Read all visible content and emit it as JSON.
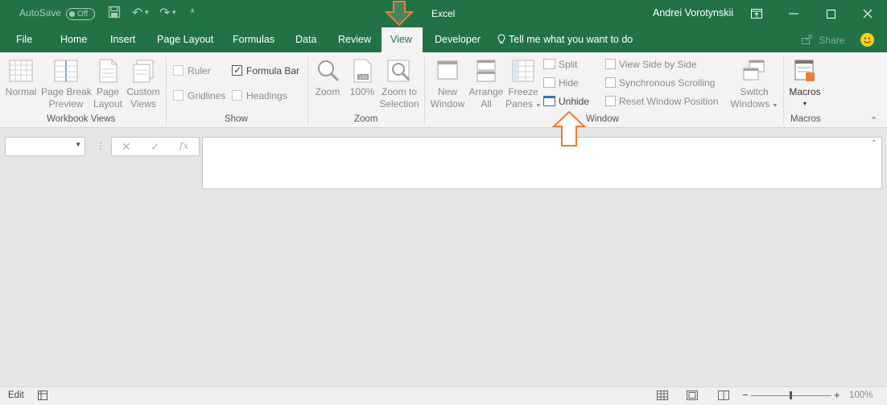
{
  "app": {
    "title": "Excel",
    "user": "Andrei Vorotynskii"
  },
  "quick_access": {
    "autosave_label": "AutoSave",
    "autosave_state": "Off"
  },
  "tell_me": "Tell me what you want to do",
  "share_label": "Share",
  "tabs": [
    {
      "label": "File"
    },
    {
      "label": "Home"
    },
    {
      "label": "Insert"
    },
    {
      "label": "Page Layout"
    },
    {
      "label": "Formulas"
    },
    {
      "label": "Data"
    },
    {
      "label": "Review"
    },
    {
      "label": "View",
      "active": true
    },
    {
      "label": "Developer"
    }
  ],
  "ribbon": {
    "workbook_views": {
      "label": "Workbook Views",
      "normal": [
        "Normal"
      ],
      "page_break": [
        "Page Break",
        "Preview"
      ],
      "page_layout": [
        "Page",
        "Layout"
      ],
      "custom": [
        "Custom",
        "Views"
      ]
    },
    "show": {
      "label": "Show",
      "ruler": "Ruler",
      "formula_bar": "Formula Bar",
      "gridlines": "Gridlines",
      "headings": "Headings"
    },
    "zoom": {
      "label": "Zoom",
      "zoom": "Zoom",
      "hundred": "100%",
      "zoom_sel": [
        "Zoom to",
        "Selection"
      ]
    },
    "window": {
      "label": "Window",
      "new_window": [
        "New",
        "Window"
      ],
      "arrange_all": [
        "Arrange",
        "All"
      ],
      "freeze": [
        "Freeze",
        "Panes"
      ],
      "split": "Split",
      "hide": "Hide",
      "unhide": "Unhide",
      "side_by_side": "View Side by Side",
      "sync_scroll": "Synchronous Scrolling",
      "reset_pos": "Reset Window Position",
      "switch": [
        "Switch",
        "Windows"
      ]
    },
    "macros": {
      "label": "Macros",
      "macros": "Macros"
    }
  },
  "status": {
    "mode": "Edit",
    "zoom": "100%"
  },
  "colors": {
    "accent": "#217346",
    "annotation": "#ed7d31"
  }
}
